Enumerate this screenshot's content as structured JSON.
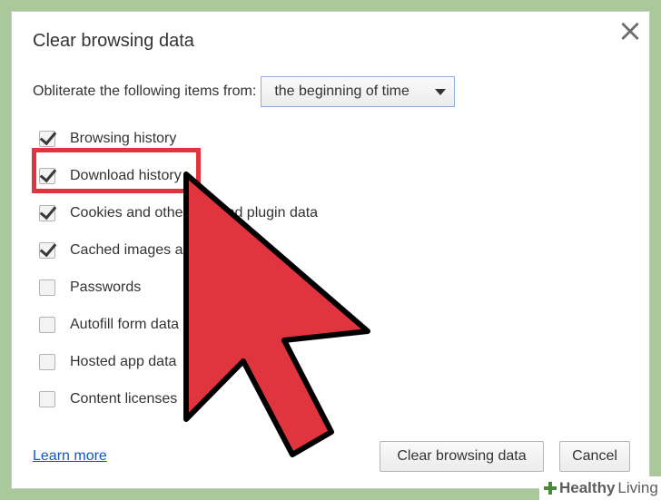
{
  "dialog": {
    "title": "Clear browsing data",
    "close_icon": "close-icon",
    "range_label": "Obliterate the following items from:",
    "range_value": "the beginning of time",
    "options": [
      {
        "label": "Browsing history",
        "checked": true
      },
      {
        "label": "Download history",
        "checked": true
      },
      {
        "label": "Cookies and other site and plugin data",
        "checked": true
      },
      {
        "label": "Cached images and files",
        "checked": true
      },
      {
        "label": "Passwords",
        "checked": false
      },
      {
        "label": "Autofill form data",
        "checked": false
      },
      {
        "label": "Hosted app data",
        "checked": false
      },
      {
        "label": "Content licenses",
        "checked": false
      }
    ],
    "learn_more": "Learn more",
    "clear_button": "Clear browsing data",
    "cancel_button": "Cancel"
  },
  "watermark": {
    "brand_bold": "Healthy",
    "brand_light": "Living"
  },
  "colors": {
    "highlight": "#e0343f",
    "arrow": "#e0343f",
    "link": "#1155cc",
    "background": "#a9c99a"
  }
}
